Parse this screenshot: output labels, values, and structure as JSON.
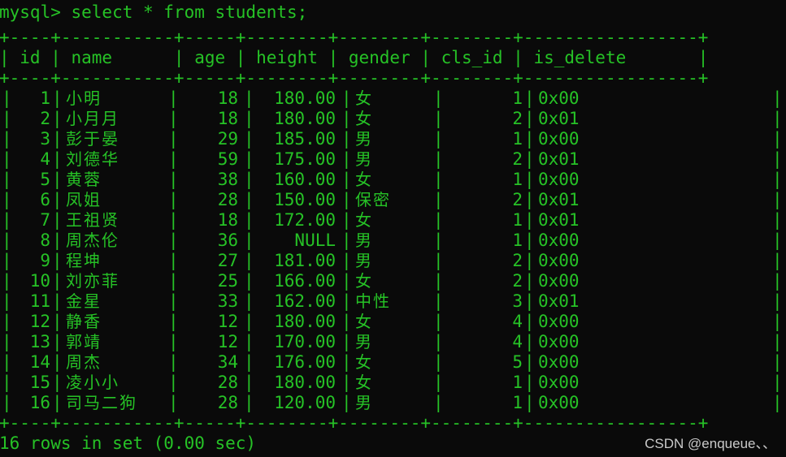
{
  "terminal": {
    "prompt": "mysql> select * from students;",
    "separator": "+----+-----------+-----+--------+--------+--------+-----------------+",
    "header_text": "| id | name      | age | height | gender | cls_id | is_delete       |",
    "footer": "16 rows in set (0.00 sec)",
    "watermark": "CSDN @enqueue、、",
    "colors": {
      "background": "#0a0a0a",
      "text": "#26c226",
      "watermark": "#c9c9c9"
    }
  },
  "table": {
    "columns": [
      "id",
      "name",
      "age",
      "height",
      "gender",
      "cls_id",
      "is_delete"
    ],
    "pipe": "|",
    "rows": [
      {
        "id": "1",
        "name": "小明",
        "age": "18",
        "height": "180.00",
        "gender": "女",
        "cls_id": "1",
        "is_delete": "0x00"
      },
      {
        "id": "2",
        "name": "小月月",
        "age": "18",
        "height": "180.00",
        "gender": "女",
        "cls_id": "2",
        "is_delete": "0x01"
      },
      {
        "id": "3",
        "name": "彭于晏",
        "age": "29",
        "height": "185.00",
        "gender": "男",
        "cls_id": "1",
        "is_delete": "0x00"
      },
      {
        "id": "4",
        "name": "刘德华",
        "age": "59",
        "height": "175.00",
        "gender": "男",
        "cls_id": "2",
        "is_delete": "0x01"
      },
      {
        "id": "5",
        "name": "黄蓉",
        "age": "38",
        "height": "160.00",
        "gender": "女",
        "cls_id": "1",
        "is_delete": "0x00"
      },
      {
        "id": "6",
        "name": "凤姐",
        "age": "28",
        "height": "150.00",
        "gender": "保密",
        "cls_id": "2",
        "is_delete": "0x01"
      },
      {
        "id": "7",
        "name": "王祖贤",
        "age": "18",
        "height": "172.00",
        "gender": "女",
        "cls_id": "1",
        "is_delete": "0x01"
      },
      {
        "id": "8",
        "name": "周杰伦",
        "age": "36",
        "height": "NULL",
        "gender": "男",
        "cls_id": "1",
        "is_delete": "0x00"
      },
      {
        "id": "9",
        "name": "程坤",
        "age": "27",
        "height": "181.00",
        "gender": "男",
        "cls_id": "2",
        "is_delete": "0x00"
      },
      {
        "id": "10",
        "name": "刘亦菲",
        "age": "25",
        "height": "166.00",
        "gender": "女",
        "cls_id": "2",
        "is_delete": "0x00"
      },
      {
        "id": "11",
        "name": "金星",
        "age": "33",
        "height": "162.00",
        "gender": "中性",
        "cls_id": "3",
        "is_delete": "0x01"
      },
      {
        "id": "12",
        "name": "静香",
        "age": "12",
        "height": "180.00",
        "gender": "女",
        "cls_id": "4",
        "is_delete": "0x00"
      },
      {
        "id": "13",
        "name": "郭靖",
        "age": "12",
        "height": "170.00",
        "gender": "男",
        "cls_id": "4",
        "is_delete": "0x00"
      },
      {
        "id": "14",
        "name": "周杰",
        "age": "34",
        "height": "176.00",
        "gender": "女",
        "cls_id": "5",
        "is_delete": "0x00"
      },
      {
        "id": "15",
        "name": "凌小小",
        "age": "28",
        "height": "180.00",
        "gender": "女",
        "cls_id": "1",
        "is_delete": "0x00"
      },
      {
        "id": "16",
        "name": "司马二狗",
        "age": "28",
        "height": "120.00",
        "gender": "男",
        "cls_id": "1",
        "is_delete": "0x00"
      }
    ]
  }
}
